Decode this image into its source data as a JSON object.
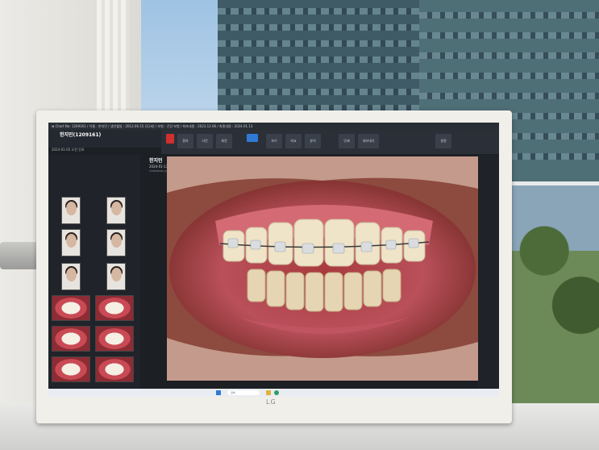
{
  "monitor": {
    "brand": "LG"
  },
  "app": {
    "title_bar": "⊠ Chart No: 1209161 / 이름 : 한지민 / 생년월일 : 2012.06.15 (11세) / 보험 : 건강 보험 / 최초내원 : 2023.12.06 / 최종내원 : 2024.01.13",
    "patient_name": "한지민(1209161)",
    "patient_date": "2024-01-05 오전 진료",
    "photo_caption_name": "한지민",
    "photo_caption_date": "2024-01-13 [Today]",
    "photo_caption_size": "3744x5616 px"
  },
  "toolbar": {
    "buttons": [
      "환자",
      "사진",
      "회전",
      "보기",
      "비교",
      "분석",
      "인쇄",
      "내보내기",
      "설정"
    ]
  },
  "taskbar": {
    "search_placeholder": "검색"
  },
  "icons": [
    "windows-start-icon",
    "search-icon",
    "folder-icon",
    "browser-icon"
  ],
  "colors": {
    "screen_bg": "#1c1f24",
    "toolbar_red": "#d0302e",
    "toolbar_blue": "#2f7ad6",
    "monitor_frame": "#f1efea"
  }
}
